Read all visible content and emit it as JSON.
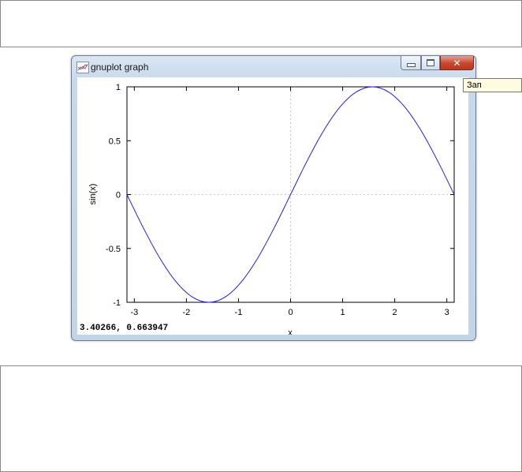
{
  "window": {
    "title": "gnuplot graph",
    "close_glyph": "✕"
  },
  "status": {
    "coordinates": "3.40266,  0.663947"
  },
  "tooltip": {
    "text": "Зап"
  },
  "icons": {
    "app": "gnuplot-chart-icon",
    "minimize": "minimize-icon",
    "maximize": "maximize-icon",
    "close": "close-icon"
  },
  "colors": {
    "curve": "#1f1fd9",
    "zero_axis": "#c8c8c8",
    "close_button": "#c9462c"
  },
  "chart_data": {
    "type": "line",
    "xlabel": "x",
    "ylabel": "sin(x)",
    "xlim": [
      -3.14159,
      3.14159
    ],
    "ylim": [
      -1,
      1
    ],
    "xticks": [
      "-3",
      "-2",
      "-1",
      "0",
      "1",
      "2",
      "3"
    ],
    "xtick_values": [
      -3,
      -2,
      -1,
      0,
      1,
      2,
      3
    ],
    "yticks": [
      "1",
      "0.5",
      "0",
      "-0.5",
      "-1"
    ],
    "ytick_values": [
      1,
      0.5,
      0,
      -0.5,
      -1
    ],
    "grid": false,
    "zero_axes": true,
    "series": [
      {
        "x": [
          -3.1416,
          -2.8274,
          -2.5133,
          -2.1991,
          -1.885,
          -1.5708,
          -1.2566,
          -0.9425,
          -0.6283,
          -0.3142,
          0,
          0.3142,
          0.6283,
          0.9425,
          1.2566,
          1.5708,
          1.885,
          2.1991,
          2.5133,
          2.8274,
          3.1416
        ],
        "y": [
          0,
          -0.309,
          -0.5878,
          -0.809,
          -0.9511,
          -1,
          -0.9511,
          -0.809,
          -0.5878,
          -0.309,
          0,
          0.309,
          0.5878,
          0.809,
          0.9511,
          1,
          0.9511,
          0.809,
          0.5878,
          0.309,
          0
        ]
      }
    ]
  }
}
